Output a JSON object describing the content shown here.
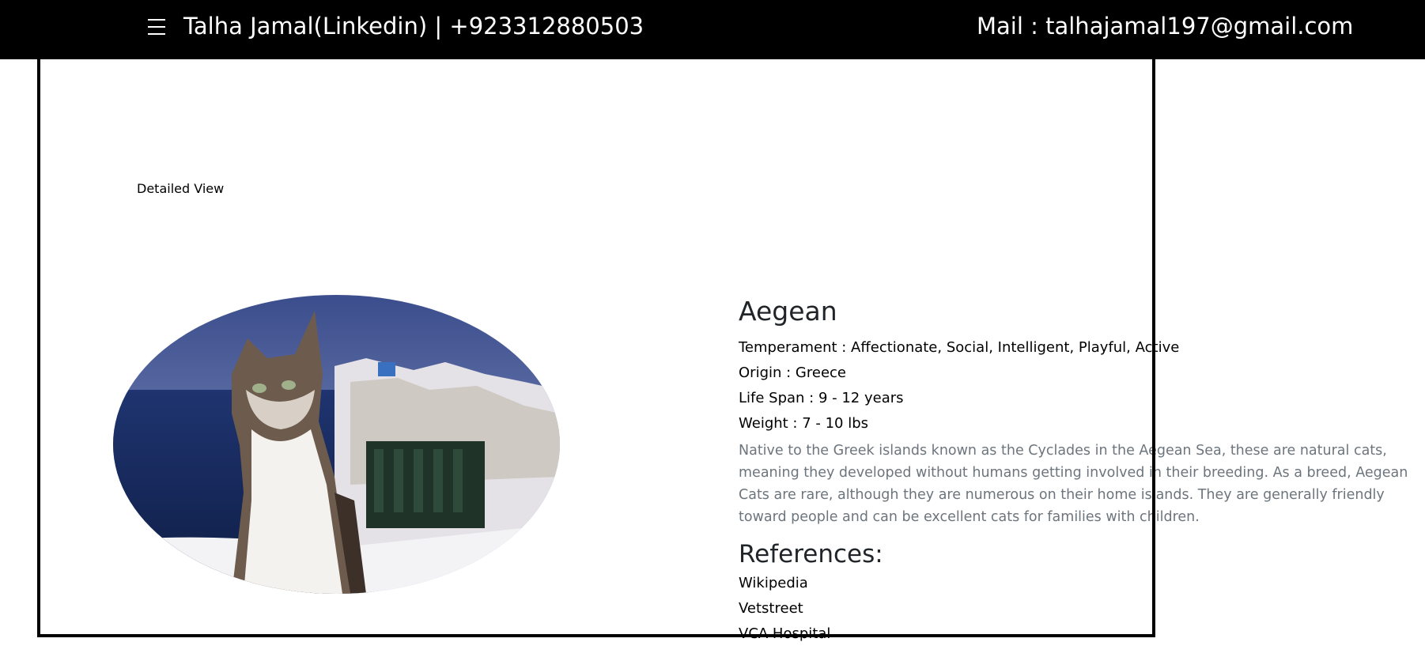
{
  "header": {
    "contact_left": "Talha Jamal(Linkedin) | +923312880503",
    "contact_right": "Mail : talhajamal197@gmail.com",
    "menu_icon": "hamburger-icon"
  },
  "page": {
    "detail_label": "Detailed View"
  },
  "breed": {
    "name": "Aegean",
    "temperament": "Temperament : Affectionate, Social, Intelligent, Playful, Active",
    "origin": "Origin : Greece",
    "life_span": "Life Span : 9 - 12 years",
    "weight": "Weight : 7 - 10 lbs",
    "description": "Native to the Greek islands known as the Cyclades in the Aegean Sea, these are natural cats, meaning they developed without humans getting involved in their breeding. As a breed, Aegean Cats are rare, although they are numerous on their home islands. They are generally friendly toward people and can be excellent cats for families with children."
  },
  "references": {
    "heading": "References:",
    "links": [
      "Wikipedia",
      "Vetstreet",
      "VCA Hospital"
    ]
  },
  "colors": {
    "topbar": "#000000",
    "description_text": "#6c757d"
  }
}
